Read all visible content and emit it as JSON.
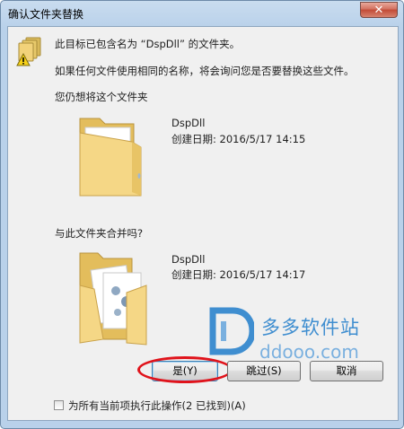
{
  "window": {
    "title": "确认文件夹替换",
    "close_glyph": "✕"
  },
  "message": {
    "line1": "此目标已包含名为 “DspDll” 的文件夹。",
    "line2": "如果任何文件使用相同的名称，将会询问您是否要替换这些文件。",
    "question": "您仍想将这个文件夹"
  },
  "existing_folder": {
    "name": "DspDll",
    "created": "创建日期: 2016/5/17 14:15",
    "icon": "open-folder-icon"
  },
  "merge_prompt": "与此文件夹合并吗?",
  "new_folder": {
    "name": "DspDll",
    "created": "创建日期: 2016/5/17 14:17",
    "icon": "folder-with-documents-icon"
  },
  "watermark": {
    "brand": "多多软件站",
    "url": "ddooo.com"
  },
  "buttons": {
    "yes": "是(Y)",
    "skip": "跳过(S)",
    "cancel": "取消"
  },
  "checkbox": {
    "label": "为所有当前项执行此操作(2 已找到)(A)",
    "checked": false
  },
  "colors": {
    "highlight": "#e0131b",
    "folder": "#f2d27a",
    "watermark": "#3f8ed0"
  }
}
